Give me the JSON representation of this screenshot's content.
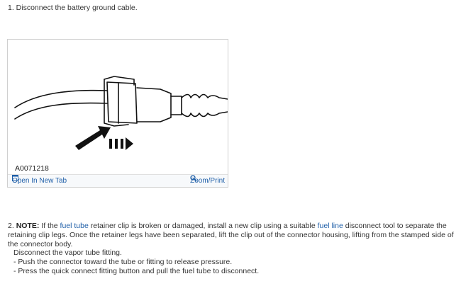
{
  "step1": {
    "text": "1. Disconnect the battery ground cable."
  },
  "figure": {
    "id_label": "A0071218",
    "open_tab_label": "Open In New Tab",
    "zoom_label": "Zoom/Print"
  },
  "step2": {
    "number": "2.",
    "note_label": "NOTE:",
    "t1": " If the ",
    "link1": "fuel tube",
    "t2": " retainer clip is broken or damaged, install a new clip using a suitable ",
    "link2": "fuel line",
    "t3": " disconnect tool to separate the retaining clip legs. Once the retainer legs have been separated, lift the clip out of the connector housing, lifting from the stamped side of the connector body."
  },
  "vapor": {
    "heading": "Disconnect the vapor tube fitting.",
    "items": [
      "- Push the connector toward the tube or fitting to release pressure.",
      "- Press the quick connect fitting button and pull the fuel tube to disconnect."
    ]
  },
  "colors": {
    "link": "#1f5fa8",
    "text": "#333333",
    "border": "#cfcfcf"
  }
}
